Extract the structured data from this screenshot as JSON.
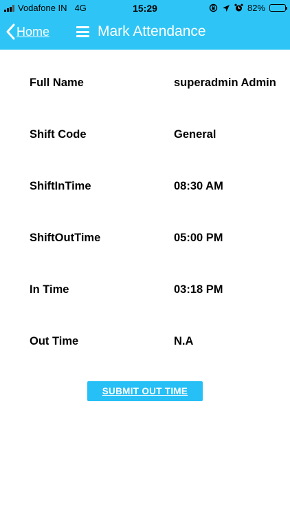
{
  "status_bar": {
    "carrier": "Vodafone IN",
    "network": "4G",
    "time": "15:29",
    "battery": "82%",
    "battery_level": 0.82,
    "battery_color": "#f6d20a"
  },
  "navbar": {
    "back_label": "Home",
    "title": "Mark Attendance",
    "background": "#2ec5f6"
  },
  "details": [
    {
      "label": "Full Name",
      "value": "superadmin Admin"
    },
    {
      "label": "Shift Code",
      "value": "General"
    },
    {
      "label": "ShiftInTime",
      "value": "08:30 AM"
    },
    {
      "label": "ShiftOutTime",
      "value": "05:00 PM"
    },
    {
      "label": "In Time",
      "value": "03:18 PM"
    },
    {
      "label": "Out Time",
      "value": "N.A"
    }
  ],
  "submit_label": "SUBMIT OUT TIME"
}
